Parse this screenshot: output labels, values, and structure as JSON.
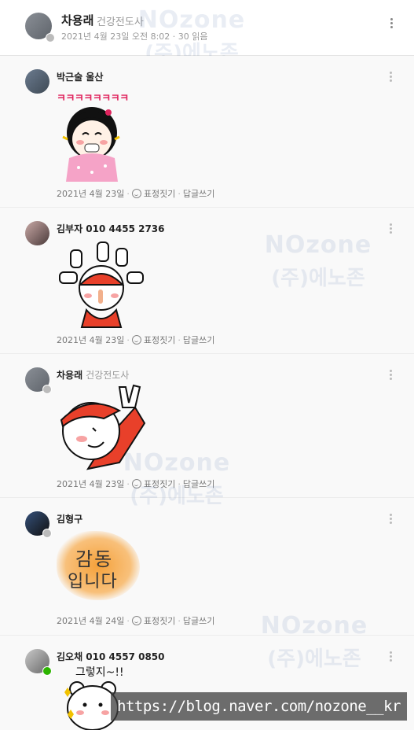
{
  "post": {
    "author": "차용래",
    "author_title": "건강전도사",
    "meta": "2021년 4월 23일 오전 8:02 · 30 읽음"
  },
  "watermark": {
    "en": "NOzone",
    "ko": "(주)에노존"
  },
  "comments": [
    {
      "name": "박근술 울산",
      "title": "",
      "text": "ㅋㅋㅋㅋㅋㅋㅋㅋ",
      "date": "2021년 4월 23일",
      "react": "표정짓기",
      "reply": "답글쓰기",
      "sticker": "laughing-girl-sticker"
    },
    {
      "name": "김부자 010 4455 2736",
      "title": "",
      "date": "2021년 4월 23일",
      "react": "표정짓기",
      "reply": "답글쓰기",
      "sticker": "thumbs-up-sticker"
    },
    {
      "name": "차용래",
      "title": "건강전도사",
      "date": "2021년 4월 23일",
      "react": "표정짓기",
      "reply": "답글쓰기",
      "sticker": "peace-sign-sticker"
    },
    {
      "name": "김형구",
      "title": "",
      "date": "2021년 4월 24일",
      "react": "표정짓기",
      "reply": "답글쓰기",
      "sticker": "calligraphy-sticker",
      "sticker_text_1": "감동",
      "sticker_text_2": "입니다"
    },
    {
      "name": "김오채 010 4557 0850",
      "title": "",
      "sticker": "bear-sticker",
      "sticker_text": "그렇지~!!"
    }
  ],
  "url_banner": "https://blog.naver.com/nozone__kr",
  "colors": {
    "kk_text": "#e0245e",
    "badge_green": "#2db400"
  }
}
